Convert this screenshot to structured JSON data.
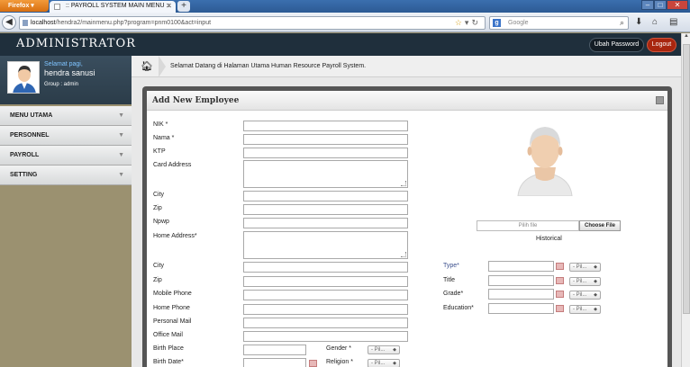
{
  "browser": {
    "name": "Firefox",
    "tab_title": ":: PAYROLL SYSTEM MAIN MENU ::.",
    "new_tab": "+",
    "url_host": "localhost",
    "url_path": "/hendra2/mainmenu.php?program=pnm0100&act=input",
    "search_placeholder": "Google",
    "win_min": "–",
    "win_max": "□",
    "win_close": "✕"
  },
  "header": {
    "title": "ADMINISTRATOR",
    "change_password": "Ubah Password",
    "logout": "Logout"
  },
  "user": {
    "greeting": "Selamat pagi,",
    "name": "hendra sanusi",
    "group": "Group : admin"
  },
  "menu": {
    "items": [
      {
        "label": "MENU UTAMA"
      },
      {
        "label": "PERSONNEL"
      },
      {
        "label": "PAYROLL"
      },
      {
        "label": "SETTING"
      }
    ]
  },
  "breadcrumb": {
    "text": "Selamat Datang di Halaman Utama Human Resource Payroll System."
  },
  "form": {
    "title": "Add New Employee",
    "labels": {
      "nik": "NIK *",
      "nama": "Nama *",
      "ktp": "KTP",
      "card_address": "Card Address",
      "city1": "City",
      "zip1": "Zip",
      "npwp": "Npwp",
      "home_address": "Home Address*",
      "city2": "City",
      "zip2": "Zip",
      "mobile": "Mobile Phone",
      "home_phone": "Home Phone",
      "personal_mail": "Personal Mail",
      "office_mail": "Office Mail",
      "birth_place": "Birth Place",
      "birth_date": "Birth Date*",
      "gender": "Gender *",
      "religion": "Religion *",
      "type": "Type*",
      "title": "Title",
      "grade": "Grade*",
      "education": "Education*"
    },
    "select_placeholder": "- Pil...",
    "file_placeholder": "Pilih file",
    "choose_file": "Choose File",
    "historical": "Historical"
  }
}
